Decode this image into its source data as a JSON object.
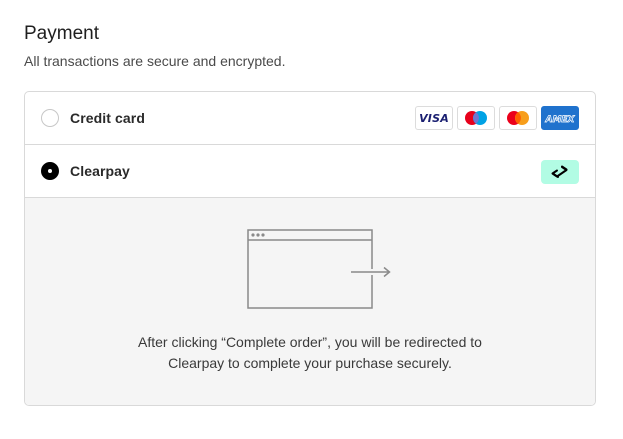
{
  "section": {
    "title": "Payment",
    "subtitle": "All transactions are secure and encrypted."
  },
  "options": {
    "credit_card": {
      "label": "Credit card",
      "selected": false,
      "card_icons": [
        {
          "name": "visa-icon",
          "text": "VISA"
        },
        {
          "name": "maestro-icon"
        },
        {
          "name": "mastercard-icon"
        },
        {
          "name": "amex-icon",
          "text": "AMEX"
        }
      ]
    },
    "clearpay": {
      "label": "Clearpay",
      "selected": true,
      "logo": "clearpay-logo-icon",
      "logo_color": "#b2fce4"
    }
  },
  "redirect_notice": {
    "line1": "After clicking “Complete order”, you will be redirected to",
    "line2": "Clearpay to complete your purchase securely."
  },
  "colors": {
    "border": "#d9d9d9",
    "detail_background": "#f5f5f5",
    "selected_radio": "#000000",
    "amex_blue": "#1f72cd",
    "visa_navy": "#1a1f71",
    "maestro_blue": "#00a2e5",
    "maestro_red": "#e7001b",
    "mastercard_red": "#eb001b",
    "mastercard_orange": "#f79e1b"
  }
}
